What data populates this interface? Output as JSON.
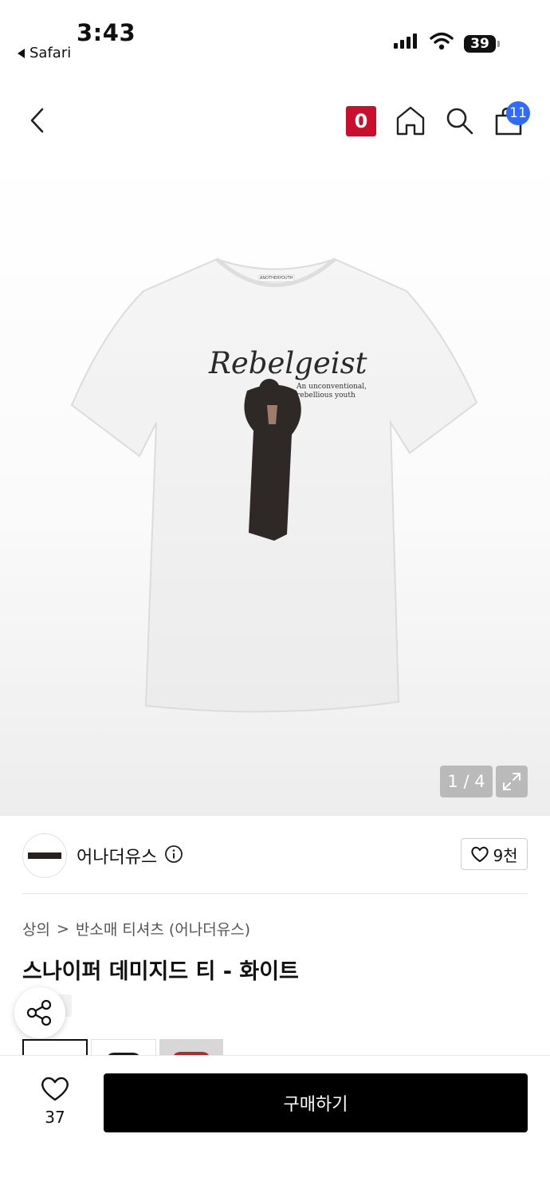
{
  "status_bar": {
    "time": "3:43",
    "back_app": "Safari",
    "battery": "39"
  },
  "nav": {
    "red_badge": "0",
    "cart_count": "11"
  },
  "image": {
    "print_title": "Rebelgeist",
    "print_subtitle_1": "An unconventional,",
    "print_subtitle_2": "rebellious youth",
    "neck_label": "ANOTHERYOUTH",
    "page_indicator": "1 / 4"
  },
  "brand": {
    "name": "어나더유스",
    "likes": "9천"
  },
  "breadcrumb": {
    "level1": "상의",
    "separator": ">",
    "level2": "반소매 티셔츠 (어나더유스)"
  },
  "product": {
    "title": "스나이퍼 데미지드 티 - 화이트"
  },
  "bottom": {
    "like_count": "37",
    "buy_label": "구매하기"
  },
  "colors": {
    "accent_red": "#c8102e",
    "badge_blue": "#2f6bff",
    "buy_button": "#000000"
  }
}
